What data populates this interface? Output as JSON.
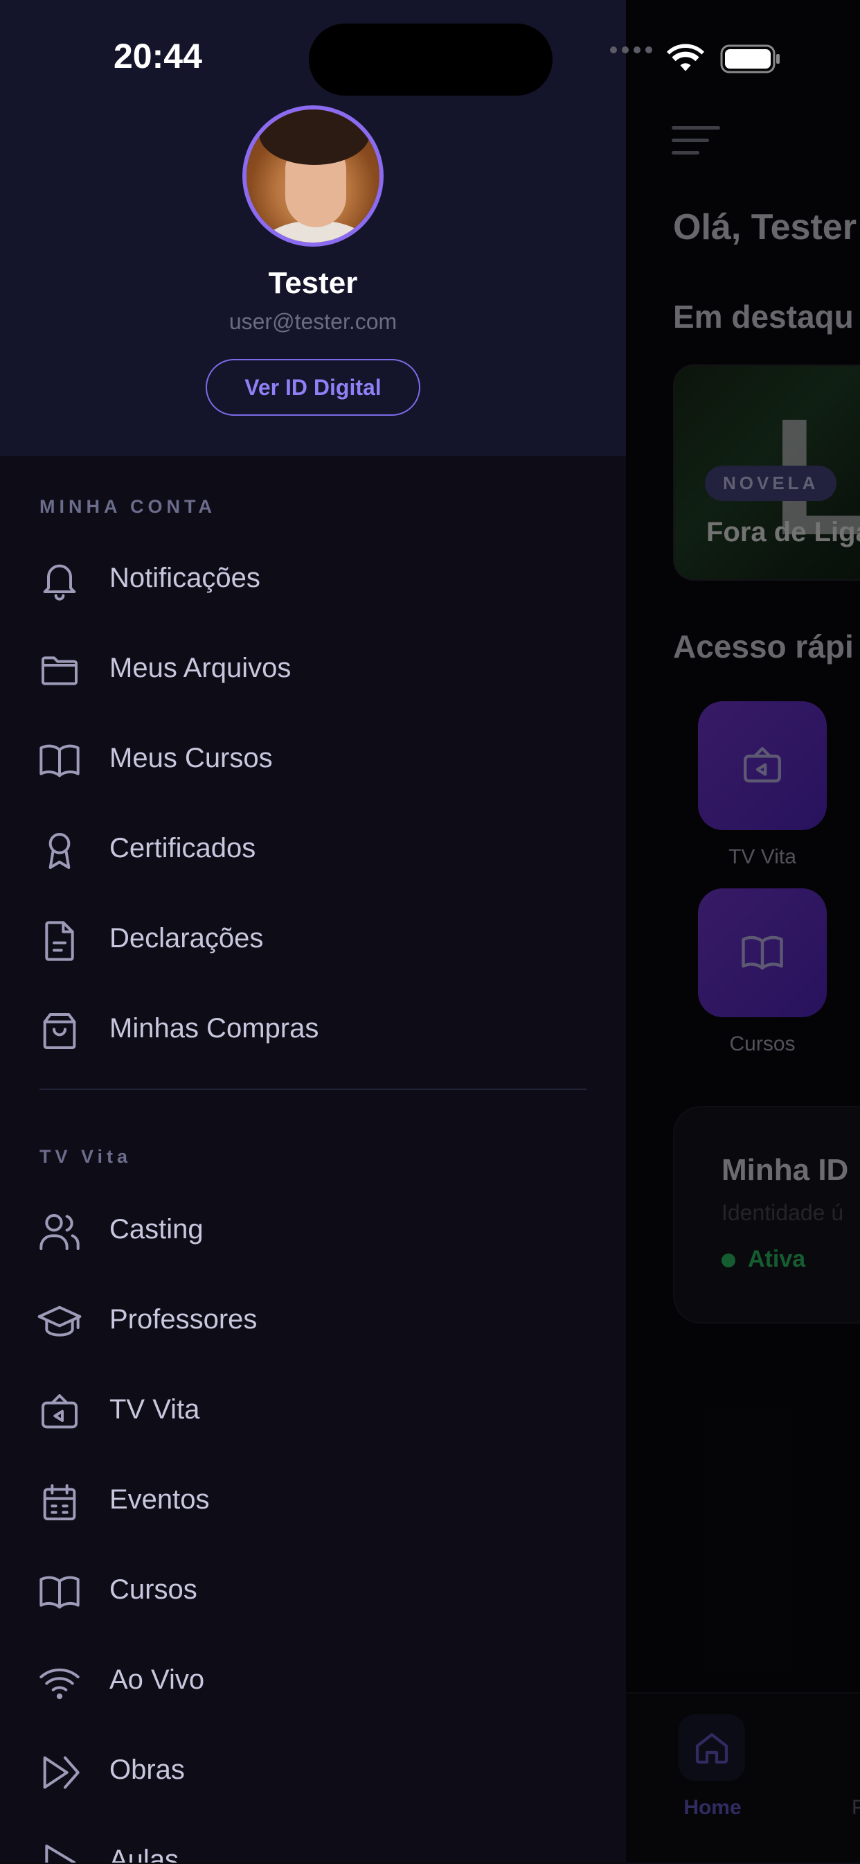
{
  "status_bar": {
    "time": "20:44"
  },
  "drawer": {
    "user": {
      "name": "Tester",
      "email": "user@tester.com",
      "id_button": "Ver ID Digital"
    },
    "sections": [
      {
        "label": "MINHA CONTA",
        "items": [
          {
            "label": "Notificações",
            "icon": "bell-icon"
          },
          {
            "label": "Meus Arquivos",
            "icon": "folder-icon"
          },
          {
            "label": "Meus Cursos",
            "icon": "book-icon"
          },
          {
            "label": "Certificados",
            "icon": "award-icon"
          },
          {
            "label": "Declarações",
            "icon": "document-icon"
          },
          {
            "label": "Minhas Compras",
            "icon": "shopping-bag-icon"
          }
        ]
      },
      {
        "label": "TV Vita",
        "items": [
          {
            "label": "Casting",
            "icon": "users-icon"
          },
          {
            "label": "Professores",
            "icon": "graduation-cap-icon"
          },
          {
            "label": "TV Vita",
            "icon": "tv-icon"
          },
          {
            "label": "Eventos",
            "icon": "calendar-icon"
          },
          {
            "label": "Cursos",
            "icon": "book-icon"
          },
          {
            "label": "Ao Vivo",
            "icon": "wifi-icon"
          },
          {
            "label": "Obras",
            "icon": "play-forward-icon"
          },
          {
            "label": "Aulas",
            "icon": "play-icon"
          }
        ]
      }
    ]
  },
  "background_app": {
    "greeting": "Olá, Tester",
    "featured_title": "Em destaqu",
    "featured": {
      "badge": "NOVELA",
      "title": "Fora de Liga"
    },
    "quick_access_title": "Acesso rápi",
    "quick_access": [
      {
        "label": "TV Vita",
        "icon": "tv-icon"
      },
      {
        "label": "Cursos",
        "icon": "book-icon"
      }
    ],
    "id_card": {
      "title": "Minha ID",
      "subtitle": "Identidade ú",
      "status": "Ativa"
    },
    "tab_bar": {
      "active_label": "Home",
      "next_label": "P"
    }
  },
  "colors": {
    "drawer_bg": "#0d0c17",
    "header_bg": "#14142a",
    "accent": "#8b6cf0",
    "menu_text": "#c9c7de",
    "status_green": "#2fcf6a"
  }
}
